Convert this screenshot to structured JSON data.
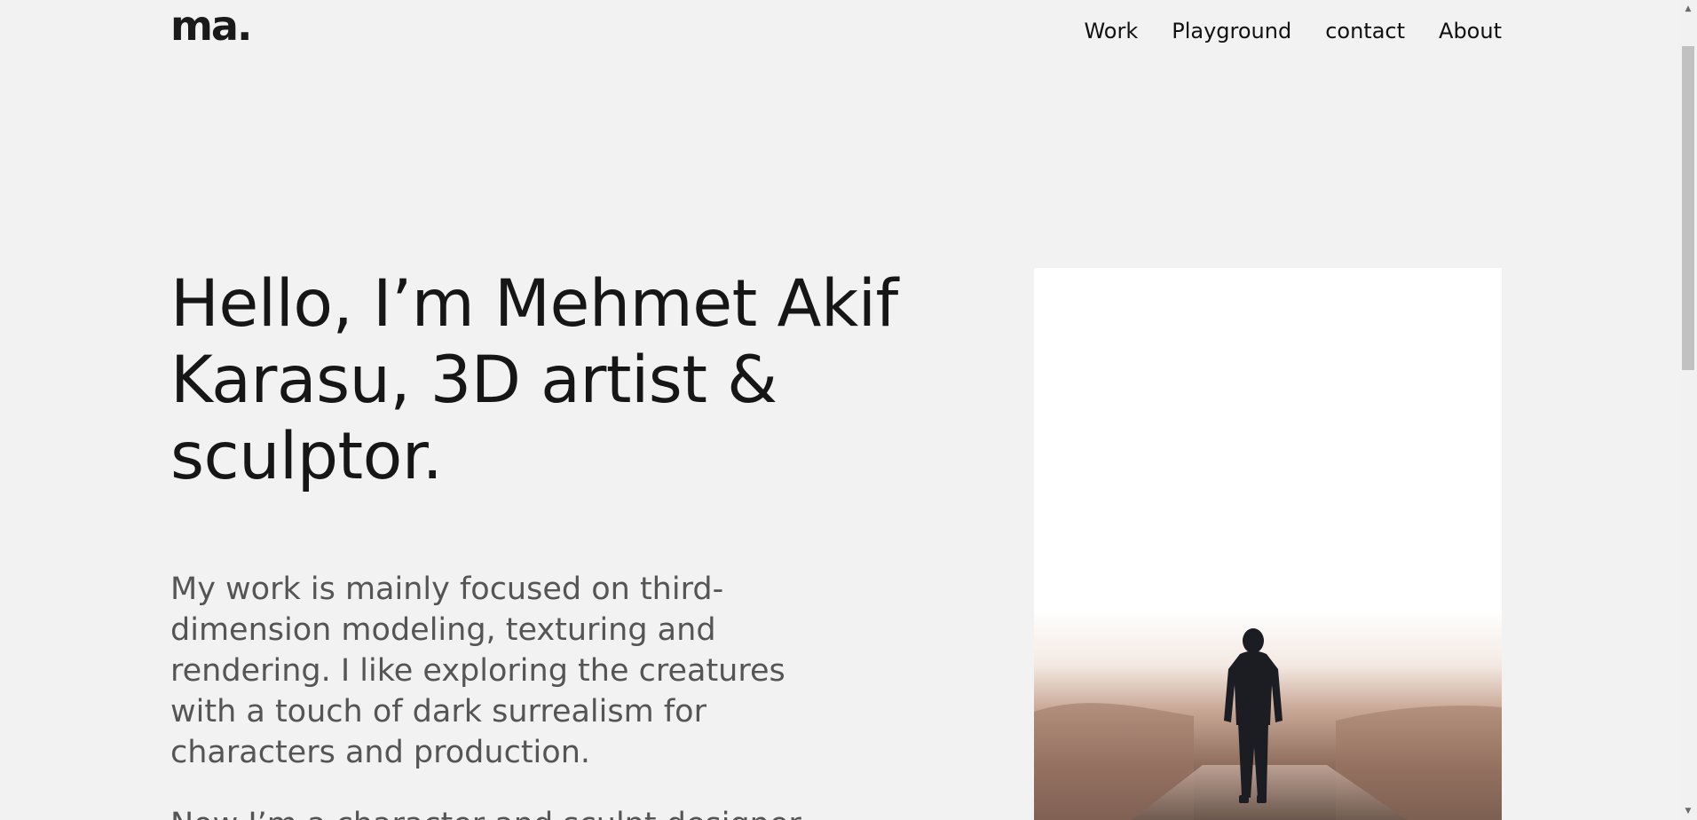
{
  "header": {
    "logo": "ma.",
    "nav": [
      {
        "label": "Work"
      },
      {
        "label": "Playground"
      },
      {
        "label": "contact"
      },
      {
        "label": "About"
      }
    ]
  },
  "hero": {
    "title": "Hello, I’m Mehmet Akif Karasu, 3D artist & sculptor.",
    "body": "My work is mainly focused on third-dimension modeling, texturing and rendering. I like exploring the creatures with a touch of dark surrealism for characters and production.",
    "body_2": "Now I’m a character and sculpt designer"
  },
  "photo": {
    "icon": "person-walking-in-fog-photo"
  },
  "scrollbar": {
    "up_icon": "▲",
    "down_icon": "▼"
  }
}
